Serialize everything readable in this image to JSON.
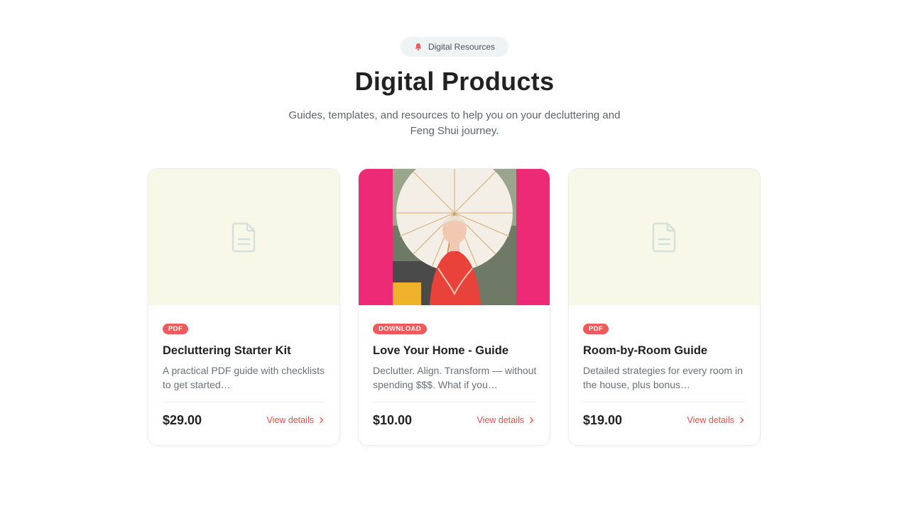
{
  "header": {
    "badge_label": "Digital Resources",
    "badge_icon": "bell-icon",
    "title": "Digital Products",
    "subtitle": "Guides, templates, and resources to help you on your decluttering and Feng Shui journey."
  },
  "colors": {
    "accent": "#f05a5a",
    "link": "#e2504d",
    "placeholder_bg": "#f7f8e7",
    "photo_bg": "#ec2a75"
  },
  "products": [
    {
      "tag": "PDF",
      "name": "Decluttering Starter Kit",
      "description": "A practical PDF guide with checklists to get started…",
      "price": "$29.00",
      "link_label": "View details",
      "thumbnail": "document-icon"
    },
    {
      "tag": "DOWNLOAD",
      "name": "Love Your Home - Guide",
      "description": "Declutter. Align. Transform — without spending $$$. What if you…",
      "price": "$10.00",
      "link_label": "View details",
      "thumbnail": "photo"
    },
    {
      "tag": "PDF",
      "name": "Room-by-Room Guide",
      "description": "Detailed strategies for every room in the house, plus bonus…",
      "price": "$19.00",
      "link_label": "View details",
      "thumbnail": "document-icon"
    }
  ]
}
